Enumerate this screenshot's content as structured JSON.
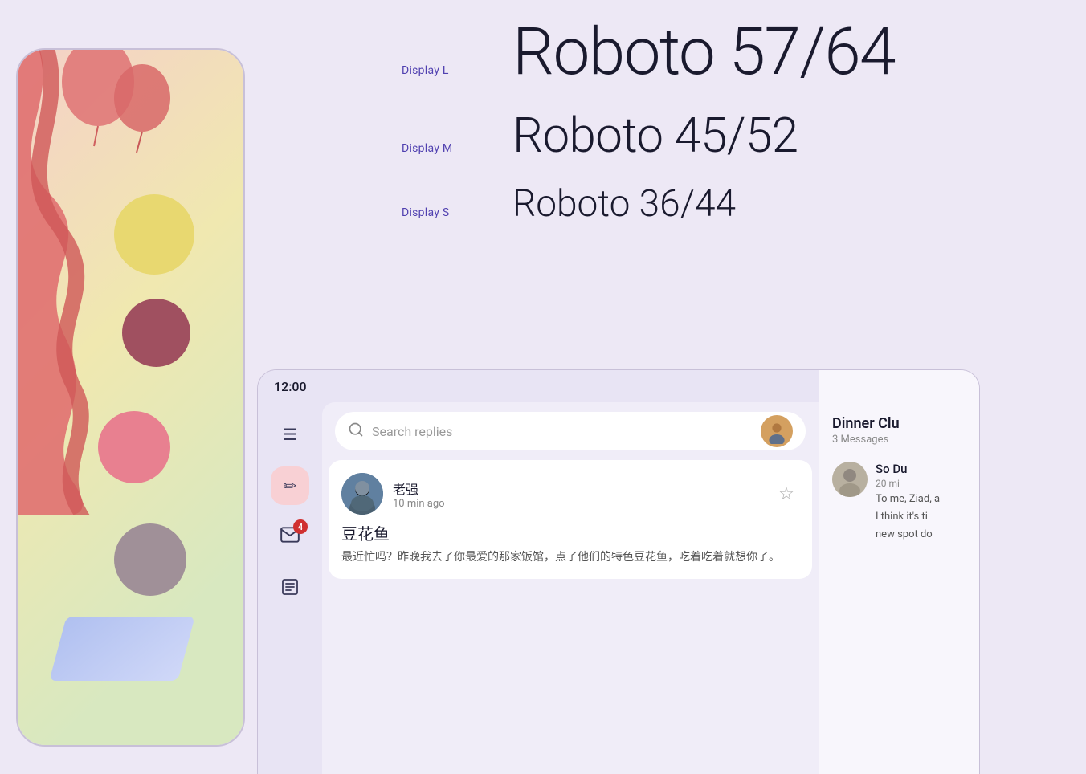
{
  "page": {
    "background_color": "#ede8f5"
  },
  "typography": {
    "display_l": {
      "label": "Display L",
      "text": "Roboto 57/64",
      "size": "57/64"
    },
    "display_m": {
      "label": "Display M",
      "text": "Roboto 45/52",
      "size": "45/52"
    },
    "display_s": {
      "label": "Display S",
      "text": "Roboto 36/44",
      "size": "36/44"
    }
  },
  "app_mockup": {
    "status_bar": {
      "time": "12:00"
    },
    "search": {
      "placeholder": "Search replies"
    },
    "sidebar": {
      "menu_icon": "☰",
      "fab_icon": "✏",
      "inbox_icon": "📬",
      "inbox_badge": "4",
      "notes_icon": "☰"
    },
    "message_card": {
      "contact_name": "老强",
      "time": "10 min ago",
      "title": "豆花鱼",
      "preview": "最近忙吗？昨晚我去了你最爱的那家饭馆，点了他们的特色豆花鱼，吃着吃着就想你了。"
    },
    "right_panel": {
      "title": "Dinner Clu",
      "subtitle": "3 Messages",
      "item": {
        "name": "So Du",
        "time": "20 mi",
        "text_line1": "To me, Ziad, a",
        "text_line2": "I think it's ti",
        "text_line3": "new spot do"
      }
    }
  }
}
